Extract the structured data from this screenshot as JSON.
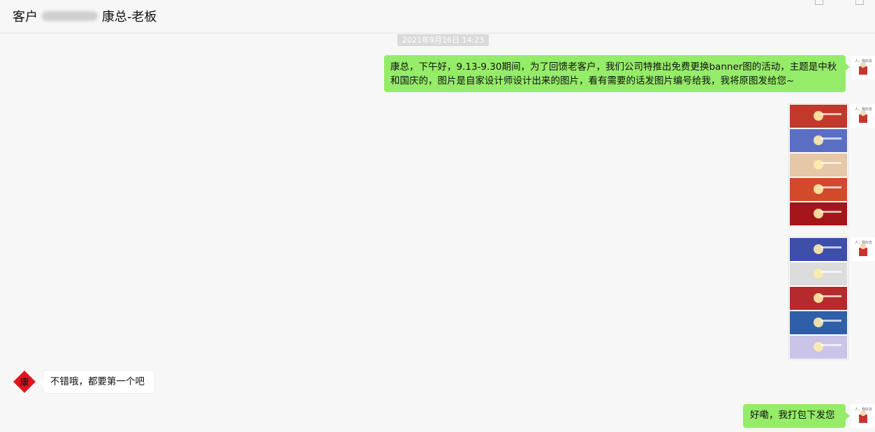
{
  "header": {
    "title_prefix": "客户",
    "title_suffix": "康总-老板"
  },
  "messages": {
    "timestamp": "2021年9月16日 14:23",
    "msg1": "康总，下午好，9.13-9.30期间，为了回馈老客户，我们公司特推出免费更换banner图的活动，主题是中秋和国庆的，图片是自家设计师设计出来的图片，看有需要的话发图片编号给我，我将原图发给您~",
    "reply": "不错哦，都要第一个吧",
    "msg2": "好嘞，我打包下发您",
    "contact_avatar_char": "康"
  },
  "images": {
    "stack1": [
      "#c0392b",
      "#5a6fc4",
      "#e6c7a8",
      "#d24a2a",
      "#a4161a"
    ],
    "stack2": [
      "#3d4fa8",
      "#dcdcdc",
      "#b52a2a",
      "#2e5fa8",
      "#c9c4e8"
    ]
  },
  "colors": {
    "my_bubble": "#95ec69",
    "background": "#f7f7f7"
  }
}
